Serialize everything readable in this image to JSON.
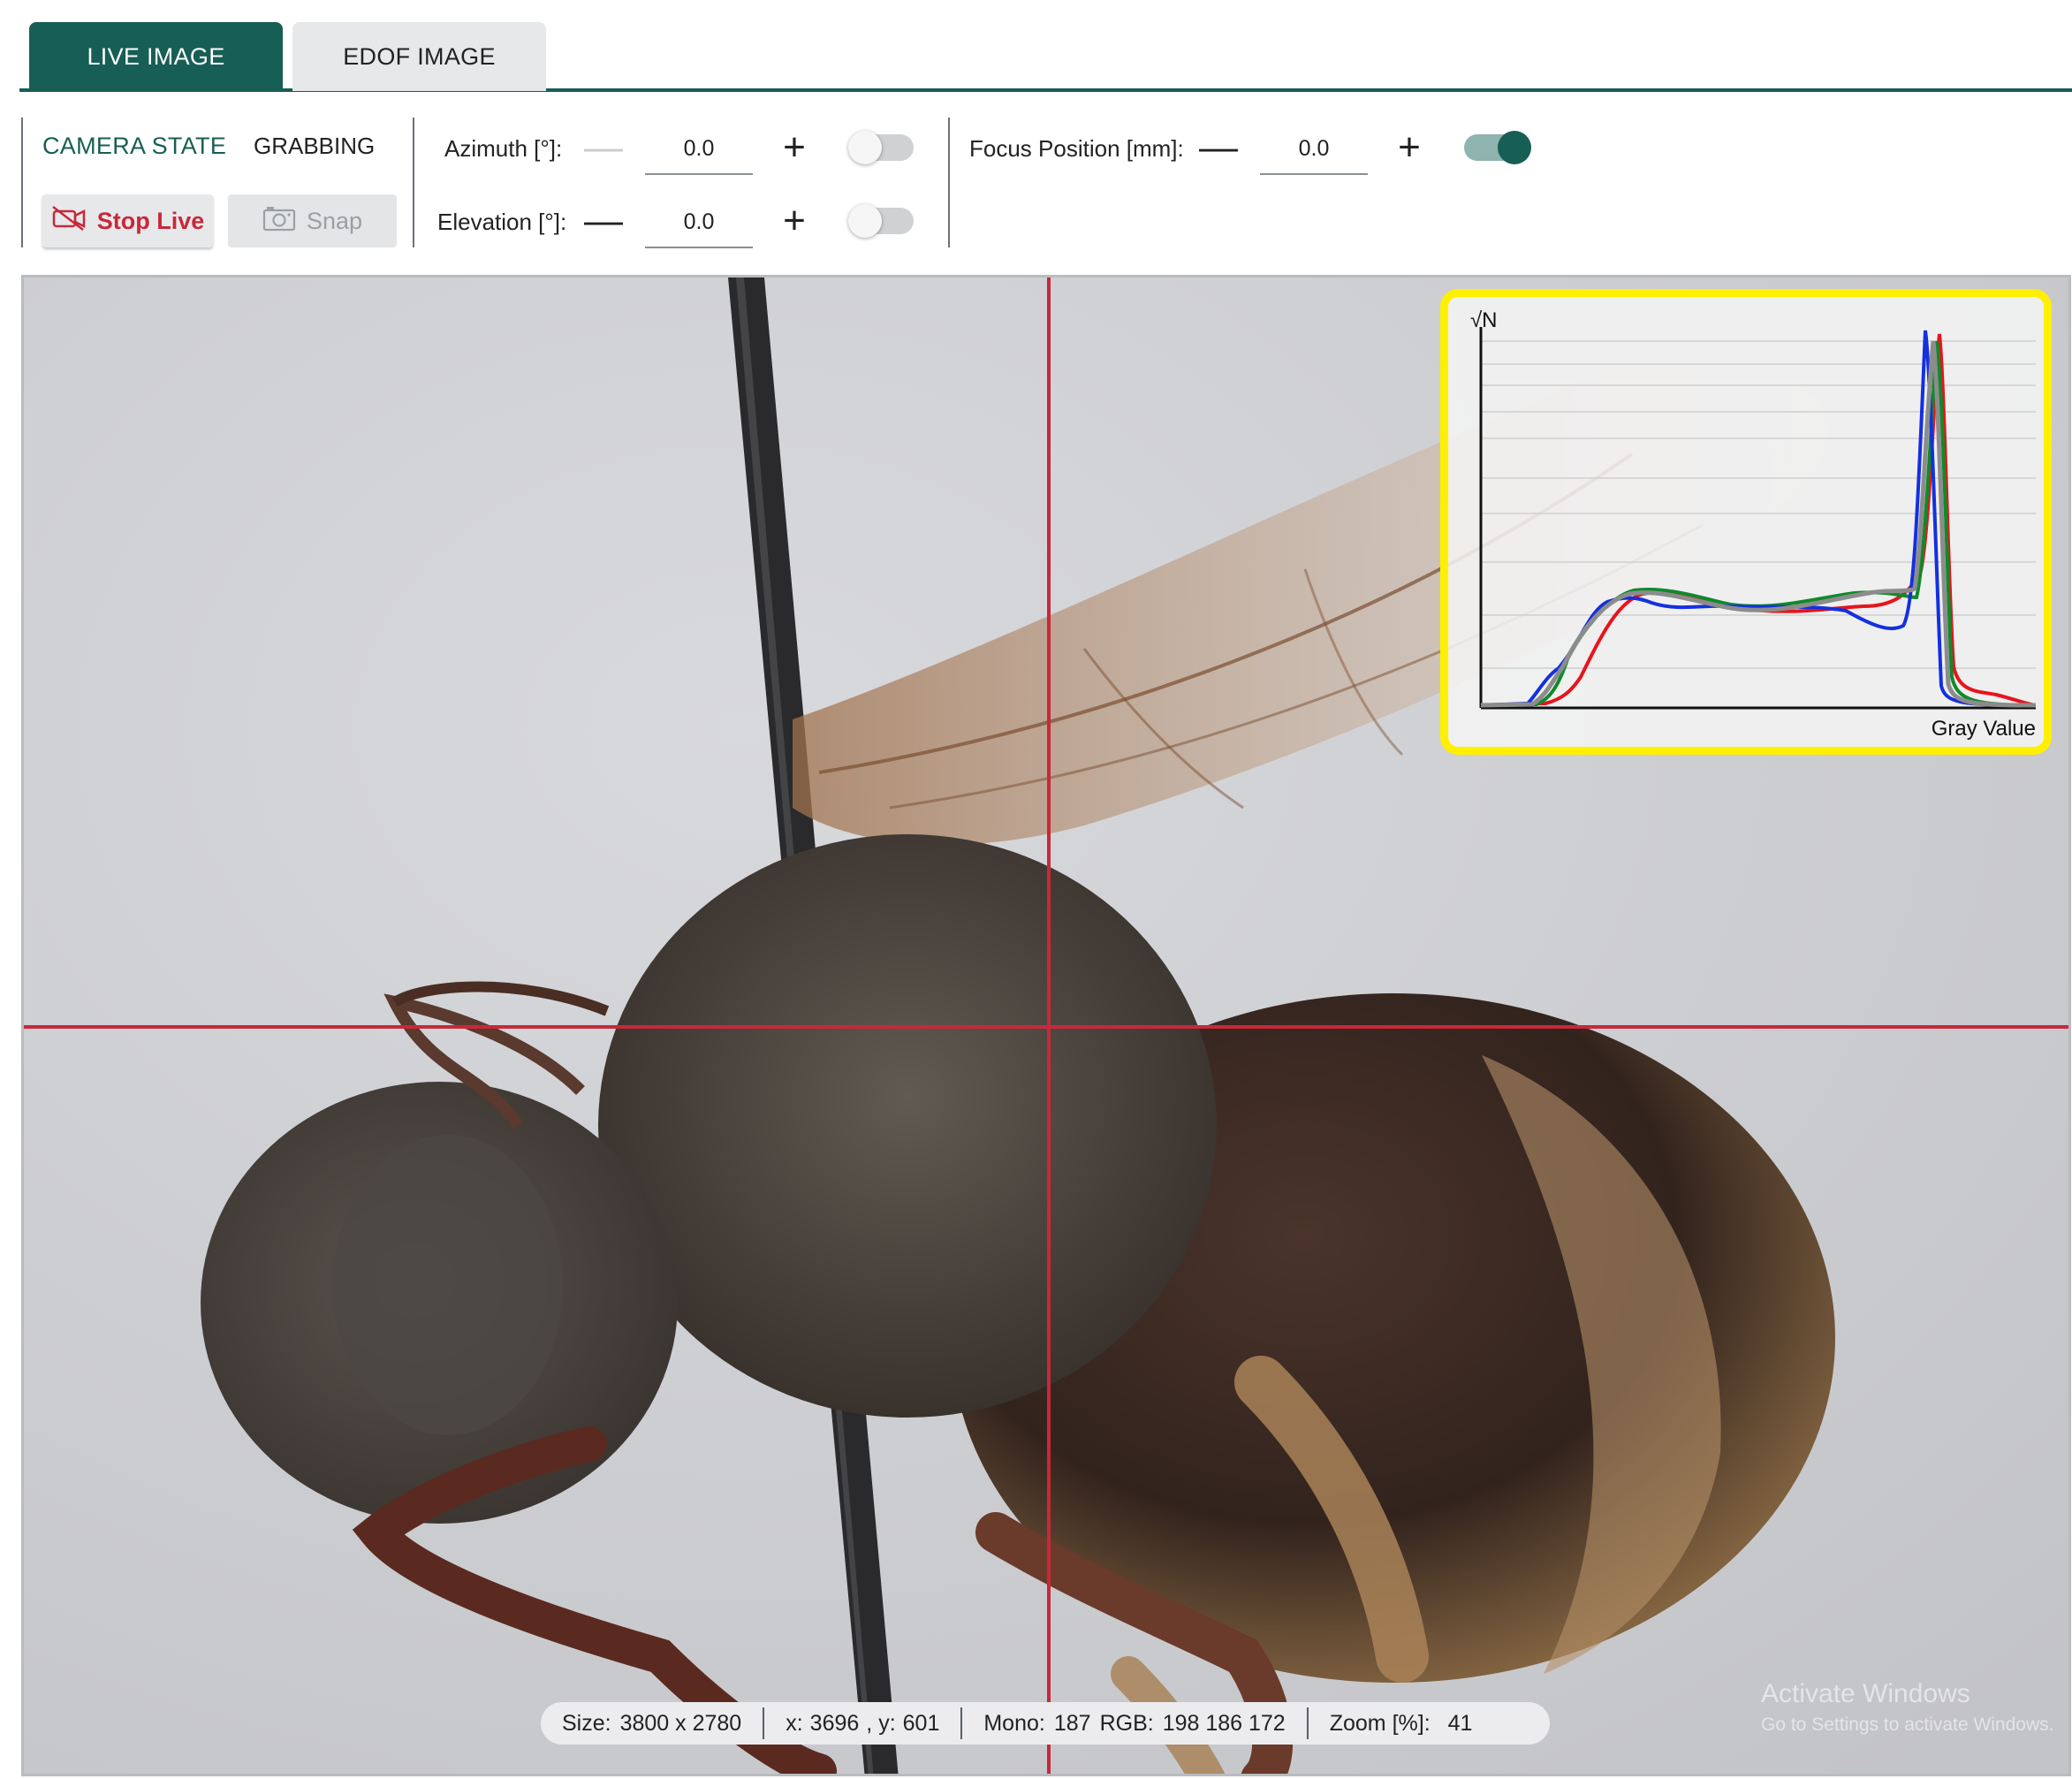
{
  "tabs": [
    {
      "label": "LIVE IMAGE",
      "active": true
    },
    {
      "label": "EDOF IMAGE",
      "active": false
    }
  ],
  "camera": {
    "state_label": "CAMERA STATE",
    "state_value": "GRABBING",
    "stop_label": "Stop Live",
    "snap_label": "Snap",
    "stop_icon": "camera-off-icon",
    "snap_icon": "camera-icon"
  },
  "azimuth": {
    "label": "Azimuth [°]:",
    "value": "0.0",
    "minus": "—",
    "plus": "+",
    "minus_enabled": false,
    "toggle_on": false
  },
  "elevation": {
    "label": "Elevation [°]:",
    "value": "0.0",
    "minus": "—",
    "plus": "+",
    "minus_enabled": true,
    "toggle_on": false
  },
  "focus": {
    "label": "Focus Position [mm]:",
    "value": "0.0",
    "minus": "—",
    "plus": "+",
    "toggle_on": true
  },
  "histogram": {
    "ylabel": "√N",
    "xlabel": "Gray Value",
    "colors": {
      "red": "#e8141b",
      "green": "#0f8a2a",
      "blue": "#1430e0",
      "gray": "#8c8c8c"
    }
  },
  "status": {
    "size_label": "Size:",
    "size_value": "3800 x 2780",
    "x_label": "x:",
    "x_value": "3696",
    "y_label": ", y:",
    "y_value": "601",
    "mono_label": "Mono:",
    "mono_value": "187",
    "rgb_label": "RGB:",
    "rgb_value": "198 186 172",
    "zoom_label": "Zoom [%]:",
    "zoom_value": "41"
  },
  "watermark": {
    "line1": "Activate Windows",
    "line2": "Go to Settings to activate Windows."
  },
  "colors": {
    "accent": "#175e55",
    "crosshair": "#c8283a",
    "histo_border": "#ffef00",
    "stop_text": "#c8283a"
  }
}
